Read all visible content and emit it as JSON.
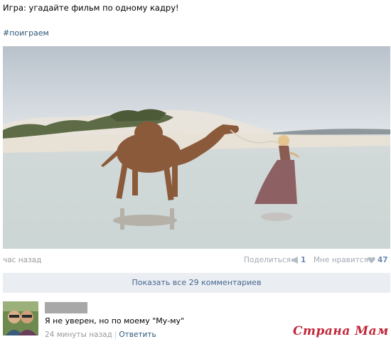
{
  "post": {
    "text": "Игра: угадайте фильм по одному кадру!",
    "hashtag": "#поиграем"
  },
  "meta": {
    "time_ago": "час назад",
    "share_label": "Поделиться",
    "share_count": "1",
    "like_label": "Мне нравится",
    "like_count": "47"
  },
  "comments_bar": {
    "label": "Показать все 29 комментариев"
  },
  "comment": {
    "text": "Я не уверен, но по моему \"Му-му\"",
    "time": "24 минуты назад",
    "reply_label": "Ответить"
  },
  "watermark": {
    "text": "Страна Мам"
  },
  "colors": {
    "link": "#2b587a",
    "bar_bg": "#eaedf2",
    "muted": "#999999",
    "watermark": "#c0283a"
  }
}
